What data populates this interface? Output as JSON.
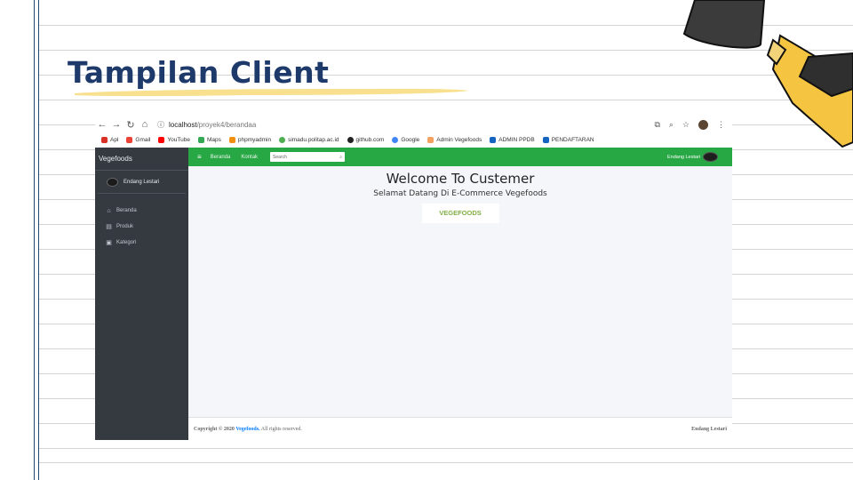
{
  "slide": {
    "title": "Tampilan Client"
  },
  "browser": {
    "url_host": "localhost",
    "url_path": "/proyek4/berandaa",
    "bookmarks": [
      "Apl",
      "Gmail",
      "YouTube",
      "Maps",
      "phpmyadmin",
      "simadu.politap.ac.id",
      "github.com",
      "Google",
      "Admin Vegefoods",
      "ADMIN PPDB",
      "PENDAFTARAN"
    ]
  },
  "app": {
    "brand": "Vegefoods",
    "user_name": "Endang Lestari",
    "menu": [
      {
        "label": "Beranda",
        "icon": "home-icon"
      },
      {
        "label": "Produk",
        "icon": "file-icon"
      },
      {
        "label": "Kategori",
        "icon": "image-icon"
      }
    ],
    "topnav": {
      "links": [
        "Beranda",
        "Kontak"
      ],
      "search_placeholder": "Search",
      "user_name": "Endang Lestari"
    },
    "main": {
      "welcome": "Welcome To Custemer",
      "subtitle": "Selamat Datang Di E-Commerce Vegefoods",
      "brand_card": "VEGEFOODS"
    },
    "footer": {
      "copyright_prefix": "Copyright © 2020",
      "brand_link": "Vegefoods.",
      "rights": "All rights reserved.",
      "author": "Endang Lestari"
    }
  },
  "colors": {
    "sidebar": "#343a40",
    "topnav": "#28a745",
    "brand_text": "#82ae46",
    "title": "#1e3a6b"
  }
}
